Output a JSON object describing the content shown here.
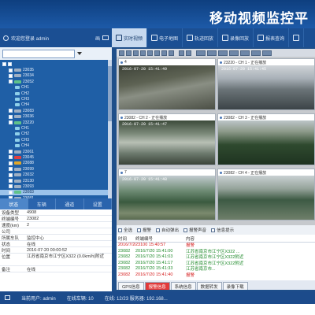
{
  "app": {
    "title": "移动视频监控平"
  },
  "toolbar": {
    "items": [
      {
        "label": "实时视频",
        "icon": "video-icon",
        "active": true
      },
      {
        "label": "电子地图",
        "icon": "map-pin-icon",
        "active": false
      },
      {
        "label": "轨迹回放",
        "icon": "track-icon",
        "active": false
      },
      {
        "label": "录像回放",
        "icon": "playback-icon",
        "active": false
      },
      {
        "label": "报表查询",
        "icon": "report-icon",
        "active": false
      },
      {
        "label": "",
        "icon": "more-icon",
        "active": false
      }
    ]
  },
  "user_bar": {
    "text": "欢迎您登录 admin",
    "tail": "画"
  },
  "search": {
    "value": ""
  },
  "tree": {
    "rows": [
      {
        "indent": 0,
        "label": "",
        "state": "group"
      },
      {
        "indent": 1,
        "label": "23035",
        "state": "off"
      },
      {
        "indent": 1,
        "label": "23034",
        "state": "off"
      },
      {
        "indent": 1,
        "label": "23052",
        "state": "on"
      },
      {
        "indent": 2,
        "label": "CH1",
        "state": "cam"
      },
      {
        "indent": 2,
        "label": "CH2",
        "state": "cam"
      },
      {
        "indent": 2,
        "label": "CH3",
        "state": "cam"
      },
      {
        "indent": 2,
        "label": "CH4",
        "state": "cam"
      },
      {
        "indent": 1,
        "label": "23083",
        "state": "off"
      },
      {
        "indent": 1,
        "label": "23036",
        "state": "off"
      },
      {
        "indent": 1,
        "label": "23220",
        "state": "on"
      },
      {
        "indent": 2,
        "label": "CH1",
        "state": "cam"
      },
      {
        "indent": 2,
        "label": "CH2",
        "state": "cam"
      },
      {
        "indent": 2,
        "label": "CH3",
        "state": "cam"
      },
      {
        "indent": 2,
        "label": "CH4",
        "state": "cam"
      },
      {
        "indent": 1,
        "label": "23061",
        "state": "off"
      },
      {
        "indent": 1,
        "label": "23045",
        "state": "alarm"
      },
      {
        "indent": 1,
        "label": "23088",
        "state": "idle"
      },
      {
        "indent": 1,
        "label": "23099",
        "state": "off"
      },
      {
        "indent": 1,
        "label": "23032",
        "state": "off"
      },
      {
        "indent": 1,
        "label": "23130",
        "state": "off"
      },
      {
        "indent": 1,
        "label": "23093",
        "state": "off"
      },
      {
        "indent": 1,
        "label": "23083",
        "state": "sel"
      },
      {
        "indent": 1,
        "label": "23081",
        "state": "off"
      }
    ]
  },
  "info_tabs": [
    "状态",
    "车辆",
    "通道",
    "设置"
  ],
  "info": [
    {
      "k": "设备类型",
      "v": "4908"
    },
    {
      "k": "终端编号",
      "v": "23082"
    },
    {
      "k": "速度(km)",
      "v": "2"
    },
    {
      "k": "公司",
      "v": ""
    },
    {
      "k": "所属车队",
      "v": "监控中心"
    },
    {
      "k": "状态",
      "v": "在线"
    },
    {
      "k": "时间",
      "v": "2016-07-20 00:00:52"
    },
    {
      "k": "位置",
      "v": "江苏省南京市江宁区X322 (0.0km/h)附近",
      "tall": true
    },
    {
      "k": "备注",
      "v": "在线"
    }
  ],
  "video_cells": [
    {
      "title": "4",
      "overlay": "2016-07-20 15:41:49",
      "overlay2": "",
      "scene": "drain"
    },
    {
      "title": "23220 - CH 1 - 正在播放",
      "overlay": "2016-07-20 15:41:45",
      "overlay2": "",
      "scene": "hall"
    },
    {
      "title": "23082 - CH 2 - 正在播放",
      "overlay": "2016-07-20 15:41:47",
      "overlay2": "",
      "scene": "water"
    },
    {
      "title": "23082 - CH 3 - 正在播放",
      "overlay": "",
      "overlay2": "",
      "scene": "forest"
    },
    {
      "title": "7",
      "overlay": "2016-07-20 15:41:48",
      "overlay2": "",
      "scene": "grass"
    },
    {
      "title": "23082 - CH 4 - 正在播放",
      "overlay": "",
      "overlay2": "",
      "scene": "trees"
    }
  ],
  "event_toolbar": [
    {
      "label": "全选"
    },
    {
      "label": "报警"
    },
    {
      "label": "自动弹出"
    },
    {
      "label": "报警声音"
    },
    {
      "label": "信息提示"
    }
  ],
  "events": {
    "header": [
      "时间",
      "终端编号",
      "内容"
    ],
    "rows": [
      {
        "c1": "2016/7/20",
        "c2": "23100 15:40:57",
        "c3": "报警",
        "type": "alarm"
      },
      {
        "c1": "23082",
        "c2": "2016/7/20 15:41:00",
        "c3": "江苏省南京市江宁区X322 ...",
        "type": "info"
      },
      {
        "c1": "23082",
        "c2": "2016/7/20 15:41:03",
        "c3": "江苏省南京市江宁区X322附近",
        "type": "info"
      },
      {
        "c1": "23082",
        "c2": "2016/7/20 15:41:17",
        "c3": "江苏省南京市江宁区X322附近",
        "type": "info"
      },
      {
        "c1": "23082",
        "c2": "2016/7/20 15:41:33",
        "c3": "江苏省南京市...",
        "type": "info"
      },
      {
        "c1": "23082",
        "c2": "2016/7/20 15:41:40",
        "c3": "报警",
        "type": "alarm"
      }
    ]
  },
  "event_tabs": [
    {
      "label": "GPS信息",
      "alarm": false
    },
    {
      "label": "报警信息",
      "alarm": true
    },
    {
      "label": "系统信息",
      "alarm": false
    },
    {
      "label": "数据转发",
      "alarm": false
    },
    {
      "label": "录像下载",
      "alarm": false
    }
  ],
  "status": {
    "left": "当前用户: admin",
    "middle": "在线车辆: 10",
    "right": "在线: 12/23  服务器: 192.168..."
  }
}
